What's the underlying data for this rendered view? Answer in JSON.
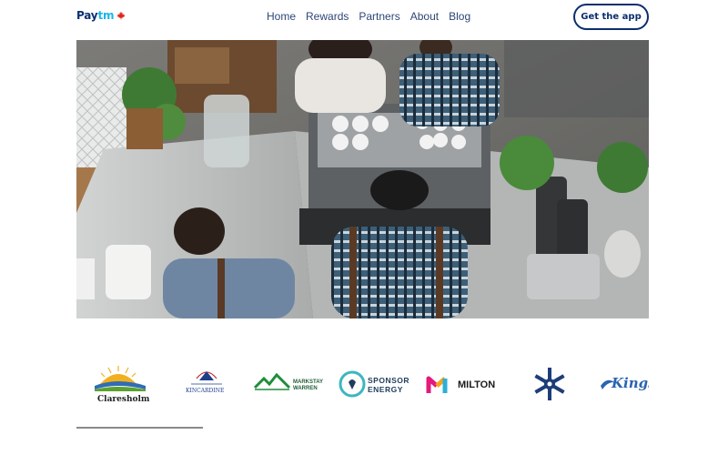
{
  "header": {
    "logo": {
      "brand_pay": "Pay",
      "brand_tm": "tm",
      "flag_icon": "maple-leaf-icon"
    },
    "nav": [
      {
        "label": "Home"
      },
      {
        "label": "Rewards"
      },
      {
        "label": "Partners"
      },
      {
        "label": "About"
      },
      {
        "label": "Blog"
      }
    ],
    "cta_label": "Get the app"
  },
  "hero": {
    "description_icon": "coffee-shop-photo"
  },
  "partners": [
    {
      "name": "Claresholm"
    },
    {
      "name": "KINCARDINE"
    },
    {
      "name": "MARKSTAY WARREN"
    },
    {
      "name": "SPONSOR ENERGY"
    },
    {
      "name": "MILTON"
    },
    {
      "name": "snowflake-logo"
    },
    {
      "name": "Kings"
    }
  ],
  "colors": {
    "brand_navy": "#0b2e6e",
    "brand_cyan": "#19b5ea",
    "nav_text": "#2e4677"
  }
}
